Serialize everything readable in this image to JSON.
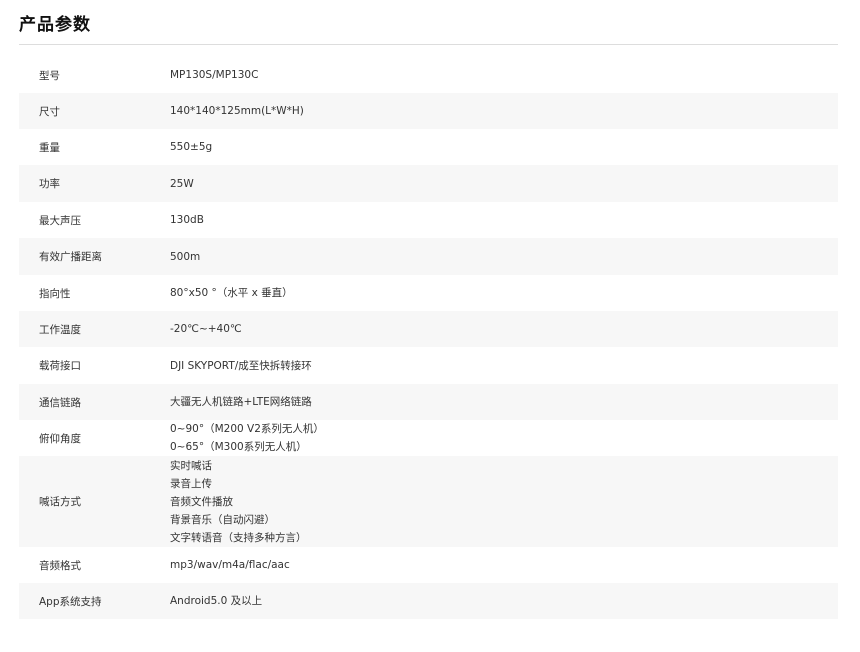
{
  "page": {
    "title": "产品参数"
  },
  "specs": [
    {
      "label": "型号",
      "values": [
        "MP130S/MP130C"
      ]
    },
    {
      "label": "尺寸",
      "values": [
        "140*140*125mm(L*W*H)"
      ]
    },
    {
      "label": "重量",
      "values": [
        "550±5g"
      ]
    },
    {
      "label": "功率",
      "values": [
        "25W"
      ]
    },
    {
      "label": "最大声压",
      "values": [
        "130dB"
      ]
    },
    {
      "label": "有效广播距离",
      "values": [
        "500m"
      ]
    },
    {
      "label": "指向性",
      "values": [
        "80°x50 °（水平 x 垂直）"
      ]
    },
    {
      "label": "工作温度",
      "values": [
        "-20℃~+40℃"
      ]
    },
    {
      "label": "载荷接口",
      "values": [
        "DJI SKYPORT/成至快拆转接环"
      ]
    },
    {
      "label": "通信链路",
      "values": [
        "大疆无人机链路+LTE网络链路"
      ]
    },
    {
      "label": "俯仰角度",
      "values": [
        "0~90°（M200 V2系列无人机）",
        "0~65°（M300系列无人机）"
      ]
    },
    {
      "label": "喊话方式",
      "values": [
        "实时喊话",
        "录音上传",
        "音频文件播放",
        "背景音乐（自动闪避）",
        "文字转语音（支持多种方言）"
      ]
    },
    {
      "label": "音频格式",
      "values": [
        "mp3/wav/m4a/flac/aac"
      ]
    },
    {
      "label": "App系统支持",
      "values": [
        "Android5.0 及以上"
      ]
    }
  ]
}
